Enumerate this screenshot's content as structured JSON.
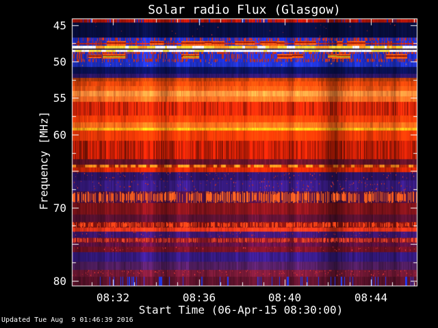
{
  "window": {
    "background": "#000000",
    "axis_color": "#ffffff",
    "text_color": "#ffffff"
  },
  "footer": {
    "updated": "Updated Tue Aug  9 01:46:39 2016"
  },
  "chart_data": {
    "type": "heatmap",
    "title": "Solar radio Flux (Glasgow)",
    "x_axis": {
      "label": "Start Time (06-Apr-15 08:30:00)",
      "range_minutes_after_0830": [
        0.09,
        16.13
      ],
      "major_ticks": [
        {
          "label": "08:32",
          "m": 2
        },
        {
          "label": "08:36",
          "m": 6
        },
        {
          "label": "08:40",
          "m": 10
        },
        {
          "label": "08:44",
          "m": 14
        }
      ],
      "minor_step_minutes": 1
    },
    "y_axis": {
      "label": "Frequency [MHz]",
      "units": "MHz",
      "range": [
        44.1,
        80.7
      ],
      "major_ticks": [
        45,
        50,
        55,
        60,
        70,
        80
      ],
      "unlabeled_major_ticks": [
        65,
        75
      ],
      "minor_step": 2.5
    },
    "legend": "none",
    "grid": "off",
    "bands": [
      {
        "f0": 44.1,
        "f1": 44.62,
        "tex": "gapnoise",
        "color": "#a81408",
        "gap": "#1f2ab0",
        "p": 0.1
      },
      {
        "f0": 44.62,
        "f1": 46.75,
        "tex": "specks",
        "color": "#070d3d",
        "speck": "#a02020",
        "p": 0.04
      },
      {
        "f0": 46.75,
        "f1": 47.15,
        "tex": "spikes",
        "color": "#1c2cc6",
        "spike": "#cc3018",
        "p": 0.3
      },
      {
        "f0": 47.15,
        "f1": 47.85,
        "tex": "bursts",
        "color": "#1c2cc6",
        "burst": "#ff5c14",
        "core": "#a01408",
        "line": "#c82414",
        "count": 14
      },
      {
        "f0": 47.85,
        "f1": 48.22,
        "tex": "mixline",
        "colors": [
          "#ffffff",
          "#ffd838",
          "#ff9c28"
        ],
        "weights": [
          0.45,
          0.35,
          0.2
        ]
      },
      {
        "f0": 48.22,
        "f1": 48.42,
        "tex": "noise",
        "color": "#2a2148"
      },
      {
        "f0": 48.42,
        "f1": 48.72,
        "tex": "mixline",
        "colors": [
          "#ffffff",
          "#ffe048"
        ],
        "weights": [
          0.75,
          0.25
        ]
      },
      {
        "f0": 48.72,
        "f1": 49.0,
        "tex": "spikes",
        "color": "#1c2cc6",
        "spike": "#cc3018",
        "p": 0.5
      },
      {
        "f0": 49.0,
        "f1": 49.62,
        "tex": "bursts",
        "color": "#1c2cc6",
        "burst": "#ff5c14",
        "core": "#8a1208",
        "alt": "#bcae24",
        "count": 14
      },
      {
        "f0": 49.62,
        "f1": 50.1,
        "tex": "spikes",
        "color": "#1c2cc6",
        "spike": "#c03018",
        "p": 0.35
      },
      {
        "f0": 50.1,
        "f1": 50.75,
        "tex": "specks",
        "color": "#1d2fbe",
        "speck": "#e07020",
        "p": 0.03
      },
      {
        "f0": 50.75,
        "f1": 51.7,
        "tex": "noise",
        "color": "#0a1156"
      },
      {
        "f0": 51.7,
        "f1": 52.25,
        "tex": "noise",
        "color": "#2c1566"
      },
      {
        "f0": 52.25,
        "f1": 52.75,
        "tex": "noise",
        "color": "#b03a0a"
      },
      {
        "f0": 52.75,
        "f1": 53.4,
        "tex": "noise",
        "color": "#e0430a"
      },
      {
        "f0": 53.4,
        "f1": 54.05,
        "tex": "noise",
        "color": "#f05512"
      },
      {
        "f0": 54.05,
        "f1": 54.8,
        "tex": "noise",
        "color": "#ff8c3a"
      },
      {
        "f0": 54.8,
        "f1": 55.5,
        "tex": "noise",
        "color": "#ff6c22"
      },
      {
        "f0": 55.5,
        "f1": 57.35,
        "tex": "stripenoise",
        "color": "#e62708"
      },
      {
        "f0": 57.35,
        "f1": 58.3,
        "tex": "noise",
        "color": "#fb3d08"
      },
      {
        "f0": 58.3,
        "f1": 59.05,
        "tex": "noise",
        "color": "#ff6a1a"
      },
      {
        "f0": 59.05,
        "f1": 59.45,
        "tex": "noise",
        "color": "#ffac14"
      },
      {
        "f0": 59.45,
        "f1": 60.85,
        "tex": "noise",
        "color": "#ee3806"
      },
      {
        "f0": 60.85,
        "f1": 63.4,
        "tex": "stripenoise",
        "color": "#c21e06"
      },
      {
        "f0": 63.4,
        "f1": 64.1,
        "tex": "noise",
        "color": "#5e1126"
      },
      {
        "f0": 64.1,
        "f1": 64.55,
        "tex": "dashes",
        "color": "#ff8c1c",
        "bg": "#a02208"
      },
      {
        "f0": 64.55,
        "f1": 65.2,
        "tex": "noise",
        "color": "#cc2506"
      },
      {
        "f0": 65.2,
        "f1": 66.25,
        "tex": "specks",
        "color": "#2b1362",
        "speck": "#c03028",
        "p": 0.18
      },
      {
        "f0": 66.25,
        "f1": 67.8,
        "tex": "specks",
        "color": "#34197a",
        "speck": "#c03028",
        "p": 0.25
      },
      {
        "f0": 67.8,
        "f1": 69.4,
        "tex": "spikes",
        "color": "#471040",
        "spike": "#ff5c20",
        "p": 0.55
      },
      {
        "f0": 69.4,
        "f1": 71.0,
        "tex": "noise",
        "color": "#7c1219"
      },
      {
        "f0": 71.0,
        "f1": 71.95,
        "tex": "noise",
        "color": "#56102f"
      },
      {
        "f0": 71.95,
        "f1": 72.7,
        "tex": "spikes",
        "color": "#7a1210",
        "spike": "#ff4418",
        "p": 0.5
      },
      {
        "f0": 72.7,
        "f1": 73.3,
        "tex": "noise",
        "color": "#e83418"
      },
      {
        "f0": 73.3,
        "f1": 74.15,
        "tex": "specks",
        "color": "#3b156c",
        "speck": "#b02828",
        "p": 0.12
      },
      {
        "f0": 74.15,
        "f1": 74.8,
        "tex": "spikes",
        "color": "#7a1422",
        "spike": "#e04028",
        "p": 0.45
      },
      {
        "f0": 74.8,
        "f1": 75.4,
        "tex": "noise",
        "color": "#5c1040"
      },
      {
        "f0": 75.4,
        "f1": 76.1,
        "tex": "specks",
        "color": "#701125",
        "speck": "#d03030",
        "p": 0.12
      },
      {
        "f0": 76.1,
        "f1": 77.45,
        "tex": "noise",
        "color": "#321878"
      },
      {
        "f0": 77.45,
        "f1": 78.55,
        "tex": "noise",
        "color": "#4a1b59"
      },
      {
        "f0": 78.55,
        "f1": 79.5,
        "tex": "specks",
        "color": "#6e1733",
        "speck": "#d03030",
        "p": 0.25
      },
      {
        "f0": 79.5,
        "f1": 80.7,
        "tex": "stripes",
        "color": "#581129",
        "stripe": "#2138f0",
        "p": 0.09
      }
    ]
  }
}
